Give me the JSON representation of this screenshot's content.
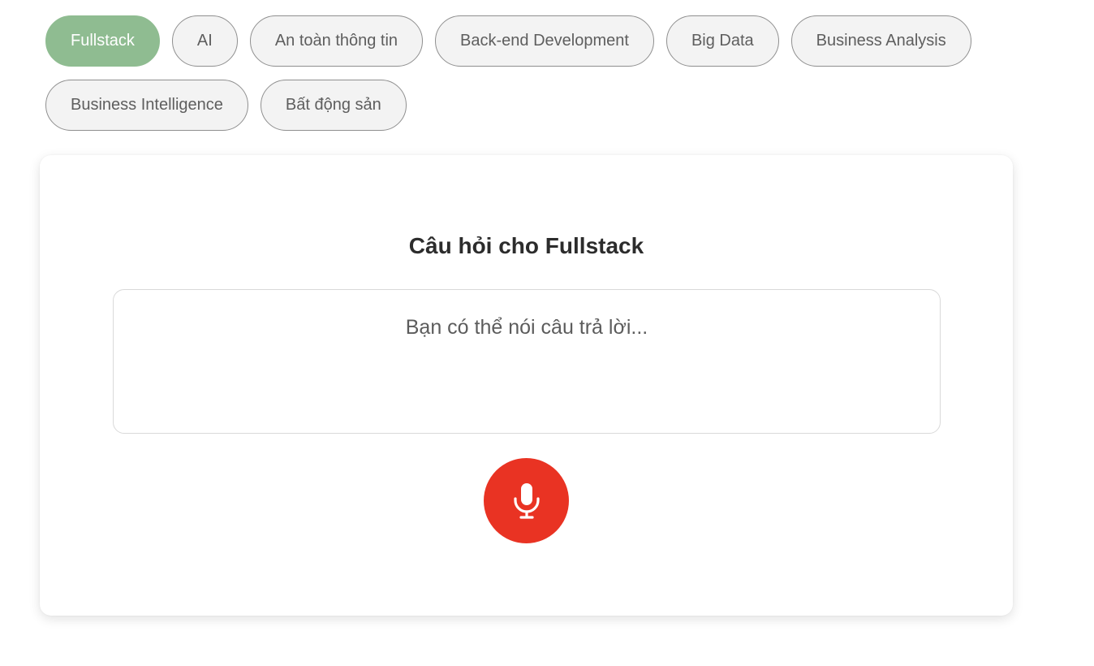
{
  "topics": [
    {
      "label": "Fullstack",
      "active": true
    },
    {
      "label": "AI",
      "active": false
    },
    {
      "label": "An toàn thông tin",
      "active": false
    },
    {
      "label": "Back-end Development",
      "active": false
    },
    {
      "label": "Big Data",
      "active": false
    },
    {
      "label": "Business Analysis",
      "active": false
    },
    {
      "label": "Business Intelligence",
      "active": false
    },
    {
      "label": "Bất động sản",
      "active": false
    }
  ],
  "card": {
    "title": "Câu hỏi cho Fullstack",
    "answer_placeholder": "Bạn có thể nói câu trả lời...",
    "mic_icon": "microphone-icon"
  },
  "colors": {
    "active_pill": "#8fbc91",
    "mic_button": "#e93323"
  }
}
